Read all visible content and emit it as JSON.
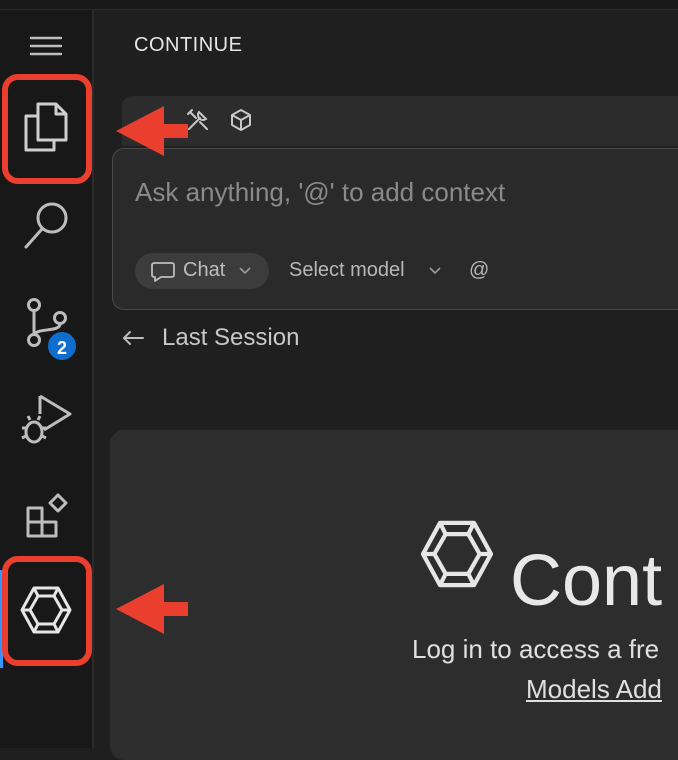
{
  "activity_bar": {
    "items": [
      {
        "icon": "menu-icon"
      },
      {
        "icon": "explorer-files-icon"
      },
      {
        "icon": "search-icon"
      },
      {
        "icon": "source-control-icon",
        "badge": "2"
      },
      {
        "icon": "run-debug-icon"
      },
      {
        "icon": "extensions-icon"
      },
      {
        "icon": "continue-logo-icon"
      }
    ],
    "highlight_color": "#ea3f2e",
    "badge_color": "#0f6ecd"
  },
  "panel": {
    "title": "CONTINUE",
    "toolbar_icons": [
      "tools-icon",
      "cube-icon"
    ],
    "input": {
      "placeholder": "Ask anything, '@' to add context",
      "mode_label": "Chat",
      "model_label": "Select model",
      "context_symbol": "@"
    },
    "last_session_label": "Last Session",
    "welcome": {
      "brand": "Cont",
      "login_text": "Log in to access a fre",
      "link_text": "Models Add"
    }
  },
  "annotations": {
    "arrow_color": "#ea3f2e"
  }
}
